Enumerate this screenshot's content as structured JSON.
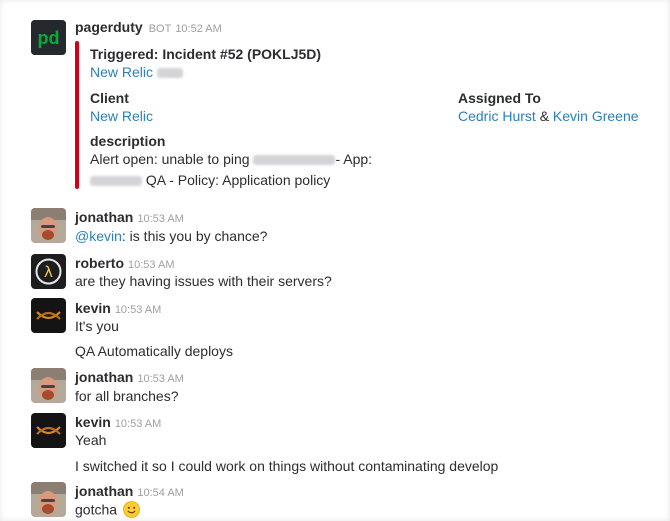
{
  "messages": {
    "pd": {
      "sender": "pagerduty",
      "badge": "BOT",
      "time": "10:52 AM",
      "avatar_icon": "pagerduty-logo-icon",
      "avatar_text": "pd",
      "attachment": {
        "title": "Triggered: Incident #52 (POKLJ5D)",
        "title_sub": "New Relic",
        "client_label": "Client",
        "client_value": "New Relic",
        "assigned_label": "Assigned To",
        "assignee1": "Cedric Hurst",
        "assignee_sep": "&",
        "assignee2": "Kevin Greene",
        "description_label": "description",
        "desc_line1_a": "Alert open: unable to ping",
        "desc_line1_b": "- App:",
        "desc_line2": "QA - Policy: Application policy",
        "accent_color": "#d0021b"
      }
    },
    "m1": {
      "sender": "jonathan",
      "time": "10:53 AM",
      "mention": "@kevin",
      "text": ": is this you by chance?"
    },
    "m2": {
      "sender": "roberto",
      "time": "10:53 AM",
      "text": "are they having issues with their servers?"
    },
    "m3": {
      "sender": "kevin",
      "time": "10:53 AM",
      "line1": "It's you",
      "line2": "QA Automatically deploys"
    },
    "m4": {
      "sender": "jonathan",
      "time": "10:53 AM",
      "text": "for all branches?"
    },
    "m5": {
      "sender": "kevin",
      "time": "10:53 AM",
      "line1": "Yeah",
      "line2": "I switched it so I could work on things without contaminating develop"
    },
    "m6": {
      "sender": "jonathan",
      "time": "10:54 AM",
      "text": "gotcha",
      "emoji": "slightly-smiling-face-icon"
    }
  },
  "colors": {
    "link": "#2a80b9",
    "pagerduty": "#06ac38",
    "timestamp": "#9e9ea6"
  }
}
